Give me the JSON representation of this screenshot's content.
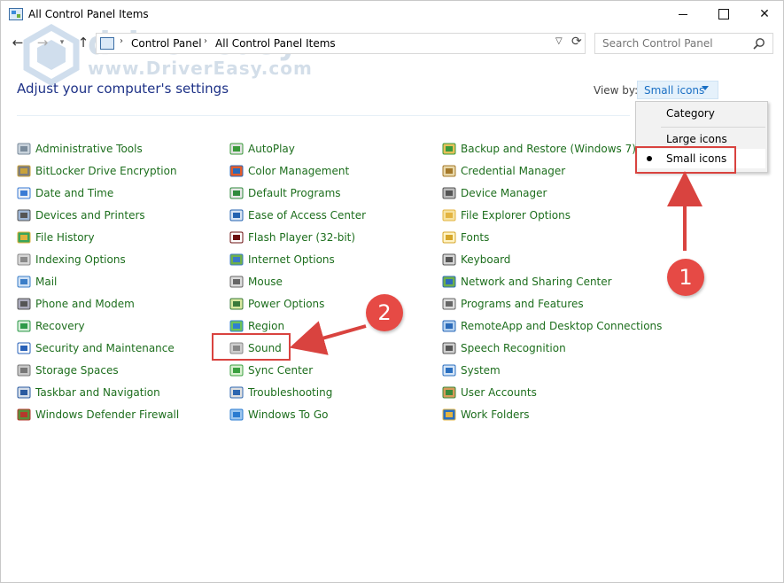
{
  "window": {
    "title": "All Control Panel Items"
  },
  "address": {
    "crumbs": [
      "Control Panel",
      "All Control Panel Items"
    ],
    "search_placeholder": "Search Control Panel"
  },
  "watermark": {
    "brand": "driver easy",
    "url": "www.DriverEasy.com"
  },
  "content": {
    "heading": "Adjust your computer's settings",
    "view_by_label": "View by:",
    "view_by_value": "Small icons"
  },
  "view_menu": {
    "options": [
      "Category",
      "Large icons",
      "Small icons"
    ],
    "selected": "Small icons"
  },
  "annotations": {
    "badge1": "1",
    "badge2": "2",
    "color": "#d9433f"
  },
  "colors": {
    "link_green": "#1d6e1d",
    "heading_blue": "#1e3287",
    "viewby_blue": "#1a6fc4"
  },
  "columns": [
    [
      {
        "label": "Administrative Tools",
        "icon": "administrative-tools-icon"
      },
      {
        "label": "BitLocker Drive Encryption",
        "icon": "bitlocker-icon"
      },
      {
        "label": "Date and Time",
        "icon": "date-time-icon"
      },
      {
        "label": "Devices and Printers",
        "icon": "devices-printers-icon"
      },
      {
        "label": "File History",
        "icon": "file-history-icon"
      },
      {
        "label": "Indexing Options",
        "icon": "indexing-options-icon"
      },
      {
        "label": "Mail",
        "icon": "mail-icon"
      },
      {
        "label": "Phone and Modem",
        "icon": "phone-modem-icon"
      },
      {
        "label": "Recovery",
        "icon": "recovery-icon"
      },
      {
        "label": "Security and Maintenance",
        "icon": "security-flag-icon"
      },
      {
        "label": "Storage Spaces",
        "icon": "storage-spaces-icon"
      },
      {
        "label": "Taskbar and Navigation",
        "icon": "taskbar-icon"
      },
      {
        "label": "Windows Defender Firewall",
        "icon": "firewall-icon"
      }
    ],
    [
      {
        "label": "AutoPlay",
        "icon": "autoplay-icon"
      },
      {
        "label": "Color Management",
        "icon": "color-management-icon"
      },
      {
        "label": "Default Programs",
        "icon": "default-programs-icon"
      },
      {
        "label": "Ease of Access Center",
        "icon": "ease-of-access-icon"
      },
      {
        "label": "Flash Player (32-bit)",
        "icon": "flash-player-icon"
      },
      {
        "label": "Internet Options",
        "icon": "internet-options-icon"
      },
      {
        "label": "Mouse",
        "icon": "mouse-icon"
      },
      {
        "label": "Power Options",
        "icon": "power-options-icon"
      },
      {
        "label": "Region",
        "icon": "region-icon"
      },
      {
        "label": "Sound",
        "icon": "speaker-icon"
      },
      {
        "label": "Sync Center",
        "icon": "sync-center-icon"
      },
      {
        "label": "Troubleshooting",
        "icon": "troubleshooting-icon"
      },
      {
        "label": "Windows To Go",
        "icon": "windows-to-go-icon"
      }
    ],
    [
      {
        "label": "Backup and Restore (Windows 7)",
        "icon": "backup-restore-icon"
      },
      {
        "label": "Credential Manager",
        "icon": "credential-manager-icon"
      },
      {
        "label": "Device Manager",
        "icon": "device-manager-icon"
      },
      {
        "label": "File Explorer Options",
        "icon": "folder-options-icon"
      },
      {
        "label": "Fonts",
        "icon": "fonts-icon"
      },
      {
        "label": "Keyboard",
        "icon": "keyboard-icon"
      },
      {
        "label": "Network and Sharing Center",
        "icon": "network-icon"
      },
      {
        "label": "Programs and Features",
        "icon": "programs-features-icon"
      },
      {
        "label": "RemoteApp and Desktop Connections",
        "icon": "remoteapp-icon"
      },
      {
        "label": "Speech Recognition",
        "icon": "microphone-icon"
      },
      {
        "label": "System",
        "icon": "system-icon"
      },
      {
        "label": "User Accounts",
        "icon": "user-accounts-icon"
      },
      {
        "label": "Work Folders",
        "icon": "work-folders-icon"
      }
    ]
  ]
}
